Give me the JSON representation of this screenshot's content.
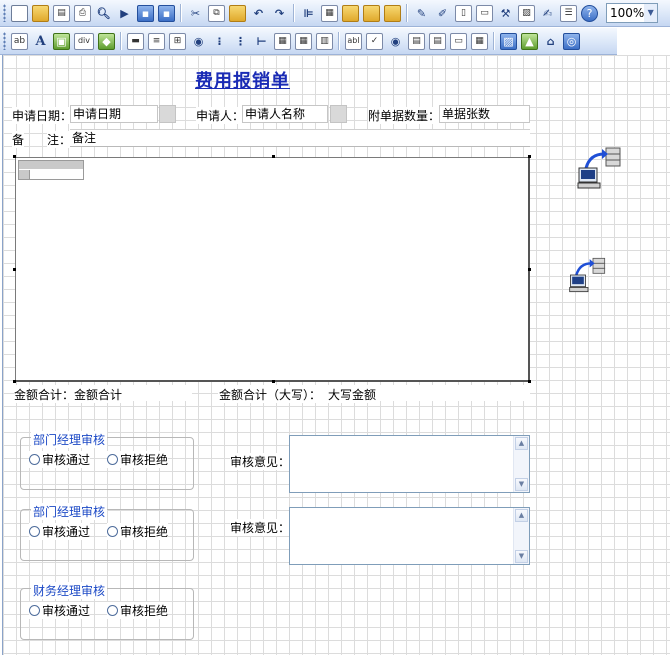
{
  "toolbar1": {
    "icons": [
      "new-doc-icon",
      "open-folder-icon",
      "print-preview-icon",
      "print-icon",
      "find-icon",
      "run-icon",
      "save-icon",
      "save-all-icon",
      "cut-icon",
      "copy-icon",
      "paste-icon",
      "undo-icon",
      "redo-icon",
      "align-icon",
      "properties-icon",
      "bring-front-icon",
      "send-back-icon",
      "group-icon",
      "edit-icon",
      "check-icon",
      "page-icon",
      "comment-icon",
      "tools-icon",
      "chart-icon",
      "report-icon",
      "list-icon",
      "help-icon"
    ],
    "zoom_value": "100%"
  },
  "toolbar2": {
    "text_icon": "A",
    "div_icon": "div"
  },
  "form": {
    "title": "费用报销单",
    "apply_date_label": "申请日期：",
    "apply_date_value": "申请日期",
    "applicant_label": "申请人：",
    "applicant_value": "申请人名称",
    "attach_count_label": "附单据数量：",
    "attach_count_value": "单据张数",
    "remark_label_a": "备",
    "remark_label_b": "注：",
    "remark_value": "备注",
    "total_label": "金额合计：",
    "total_value": "金额合计",
    "total_upper_label": "金额合计（大写）：",
    "total_upper_value": "大写金额"
  },
  "reviews": [
    {
      "legend": "部门经理审核",
      "approve": "审核通过",
      "reject": "审核拒绝",
      "opinion_label": "审核意见："
    },
    {
      "legend": "部门经理审核",
      "approve": "审核通过",
      "reject": "审核拒绝",
      "opinion_label": "审核意见："
    },
    {
      "legend": "财务经理审核",
      "approve": "审核通过",
      "reject": "审核拒绝"
    }
  ],
  "colors": {
    "title": "#1a2bb5",
    "legend": "#1d4ac6",
    "toolbar": "#dbe7f8"
  }
}
